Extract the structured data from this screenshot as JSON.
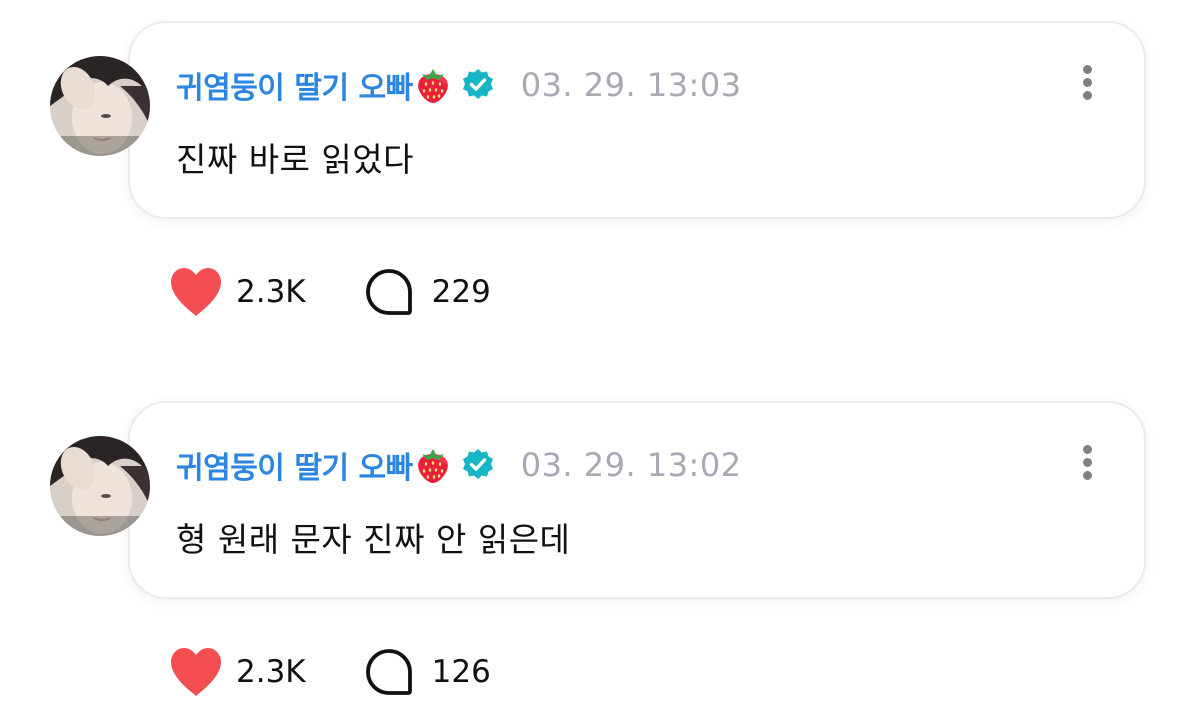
{
  "colors": {
    "username": "#2a86e0",
    "verified_badge": "#17b6c7",
    "timestamp": "#a7a9b3",
    "heart": "#f44e52",
    "text": "#111111"
  },
  "posts": [
    {
      "username": "귀염둥이 딸기 오빠",
      "username_emoji": "strawberry-icon",
      "verified": true,
      "timestamp": "03. 29. 13:03",
      "message": "진짜 바로 읽었다",
      "likes": "2.3K",
      "comments": "229"
    },
    {
      "username": "귀염둥이 딸기 오빠",
      "username_emoji": "strawberry-icon",
      "verified": true,
      "timestamp": "03. 29. 13:02",
      "message": "형 원래 문자 진짜 안 읽은데",
      "likes": "2.3K",
      "comments": "126"
    }
  ]
}
